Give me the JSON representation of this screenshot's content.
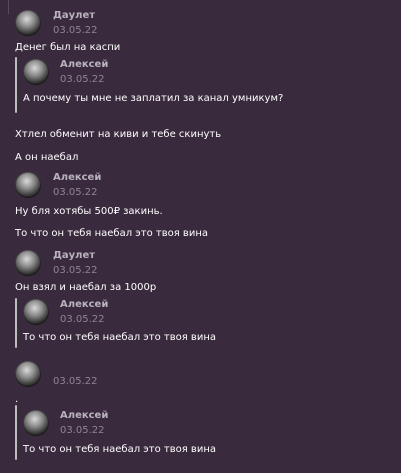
{
  "messages": {
    "m1": {
      "author": "Даулет",
      "date": "03.05.22",
      "text": "Денег был на каспи"
    },
    "q1": {
      "author": "Алексей",
      "date": "03.05.22",
      "text": "А почему ты мне не заплатил за канал умникум?"
    },
    "m2": {
      "text": "Хтлел обменит на киви и тебе скинуть"
    },
    "m3": {
      "text": "А он наебал"
    },
    "m4": {
      "author": "Алексей",
      "date": "03.05.22",
      "text": "Ну бля хотябы 500₽ закинь."
    },
    "m5": {
      "text": "То что он тебя наебал это твоя вина"
    },
    "m6": {
      "author": "Даулет",
      "date": "03.05.22",
      "text": "Он взял и наебал за 1000р"
    },
    "q2": {
      "author": "Алексей",
      "date": "03.05.22",
      "text": "То что он тебя наебал это твоя вина"
    },
    "m7": {
      "author": "",
      "date": "03.05.22",
      "text": "."
    },
    "q3": {
      "author": "Алексей",
      "date": "03.05.22",
      "text": "То что он тебя наебал это твоя вина"
    }
  }
}
